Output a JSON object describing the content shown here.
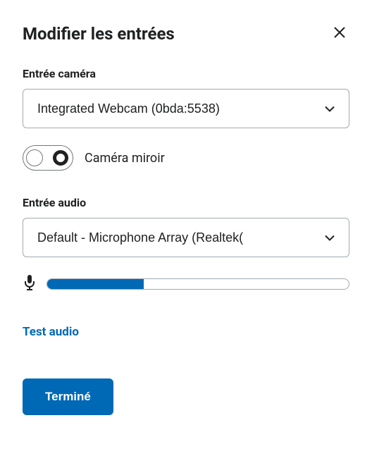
{
  "title": "Modifier les entrées",
  "camera": {
    "label": "Entrée caméra",
    "selected": "Integrated Webcam (0bda:5538)",
    "mirror_label": "Caméra miroir",
    "mirror_on": false
  },
  "audio": {
    "label": "Entrée audio",
    "selected": "Default - Microphone Array (Realtek(",
    "level_percent": 32,
    "test_label": "Test audio"
  },
  "done_label": "Terminé"
}
